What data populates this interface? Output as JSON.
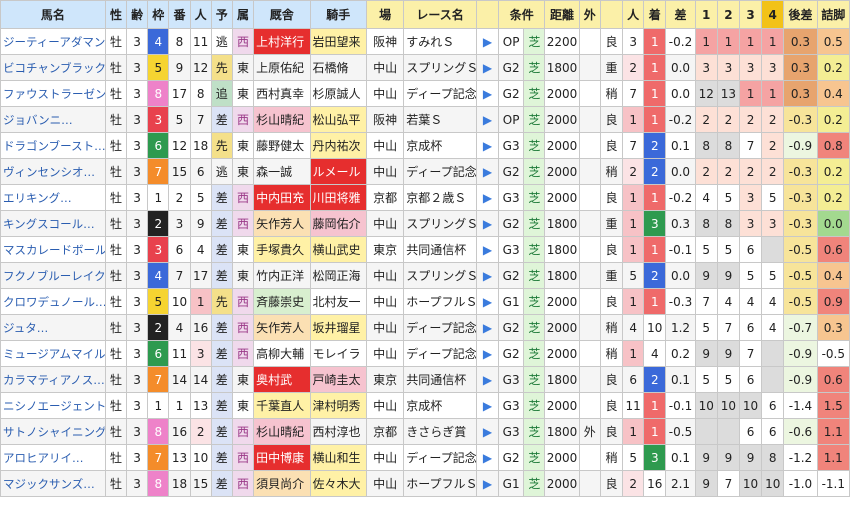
{
  "headers": [
    "馬名",
    "性",
    "齢",
    "枠",
    "番",
    "人",
    "予",
    "属",
    "厩舎",
    "騎手",
    "場",
    "レース名",
    "",
    "条件",
    "",
    "距離",
    "外",
    "",
    "人",
    "着",
    "差",
    "1",
    "2",
    "3",
    "4",
    "後差",
    "詰脚"
  ],
  "rows": [
    {
      "name": "ジーティーアダマン…",
      "sex": "牡",
      "age": "3",
      "waku": "4",
      "ban": "8",
      "pop": "11",
      "style": "逃",
      "zoku": "西",
      "trainer": "上村洋行",
      "jockey": "岩田望来",
      "place": "阪神",
      "race": "すみれＳ",
      "grade": "OP",
      "surf": "芝",
      "dist": "2200",
      "out": "",
      "cond": "良",
      "pop2": "3",
      "chaku": "1",
      "sa": "-0.2",
      "c1": "1",
      "c2": "1",
      "c3": "1",
      "c4": "1",
      "ato": "0.3",
      "tsume": "0.5"
    },
    {
      "name": "ビコチャンブラック…",
      "sex": "牡",
      "age": "3",
      "waku": "5",
      "ban": "9",
      "pop": "12",
      "style": "先",
      "zoku": "東",
      "trainer": "上原佑紀",
      "jockey": "石橋脩",
      "place": "中山",
      "race": "スプリングＳ",
      "grade": "G2",
      "surf": "芝",
      "dist": "1800",
      "out": "",
      "cond": "重",
      "pop2": "2",
      "chaku": "1",
      "sa": "0.0",
      "c1": "3",
      "c2": "3",
      "c3": "3",
      "c4": "3",
      "ato": "0.3",
      "tsume": "0.2"
    },
    {
      "name": "ファウストラーゼン…",
      "sex": "牡",
      "age": "3",
      "waku": "8",
      "ban": "17",
      "pop": "8",
      "style": "追",
      "zoku": "東",
      "trainer": "西村真幸",
      "jockey": "杉原誠人",
      "place": "中山",
      "race": "ディープ記念",
      "grade": "G2",
      "surf": "芝",
      "dist": "2000",
      "out": "",
      "cond": "稍",
      "pop2": "7",
      "chaku": "1",
      "sa": "0.0",
      "c1": "12",
      "c2": "13",
      "c3": "1",
      "c4": "1",
      "ato": "0.3",
      "tsume": "0.4"
    },
    {
      "name": "ジョバンニ…",
      "sex": "牡",
      "age": "3",
      "waku": "3",
      "ban": "5",
      "pop": "7",
      "style": "差",
      "zoku": "西",
      "trainer": "杉山晴紀",
      "jockey": "松山弘平",
      "place": "阪神",
      "race": "若葉Ｓ",
      "grade": "OP",
      "surf": "芝",
      "dist": "2000",
      "out": "",
      "cond": "良",
      "pop2": "1",
      "chaku": "1",
      "sa": "-0.2",
      "c1": "2",
      "c2": "2",
      "c3": "2",
      "c4": "2",
      "ato": "-0.3",
      "tsume": "0.2"
    },
    {
      "name": "ドラゴンブースト…",
      "sex": "牡",
      "age": "3",
      "waku": "6",
      "ban": "12",
      "pop": "18",
      "style": "先",
      "zoku": "東",
      "trainer": "藤野健太",
      "jockey": "丹内祐次",
      "place": "中山",
      "race": "京成杯",
      "grade": "G3",
      "surf": "芝",
      "dist": "2000",
      "out": "",
      "cond": "良",
      "pop2": "7",
      "chaku": "2",
      "sa": "0.1",
      "c1": "8",
      "c2": "8",
      "c3": "7",
      "c4": "2",
      "ato": "-0.9",
      "tsume": "0.8"
    },
    {
      "name": "ヴィンセンシオ…",
      "sex": "牡",
      "age": "3",
      "waku": "7",
      "ban": "15",
      "pop": "6",
      "style": "逃",
      "zoku": "東",
      "trainer": "森一誠",
      "jockey": "ルメール",
      "place": "中山",
      "race": "ディープ記念",
      "grade": "G2",
      "surf": "芝",
      "dist": "2000",
      "out": "",
      "cond": "稍",
      "pop2": "2",
      "chaku": "2",
      "sa": "0.0",
      "c1": "2",
      "c2": "2",
      "c3": "2",
      "c4": "2",
      "ato": "-0.3",
      "tsume": "0.2"
    },
    {
      "name": "エリキング…",
      "sex": "牡",
      "age": "3",
      "waku": "1",
      "ban": "2",
      "pop": "5",
      "style": "差",
      "zoku": "西",
      "trainer": "中内田充",
      "jockey": "川田将雅",
      "place": "京都",
      "race": "京都２歳Ｓ",
      "grade": "G3",
      "surf": "芝",
      "dist": "2000",
      "out": "",
      "cond": "良",
      "pop2": "1",
      "chaku": "1",
      "sa": "-0.2",
      "c1": "4",
      "c2": "5",
      "c3": "3",
      "c4": "5",
      "ato": "-0.3",
      "tsume": "0.2"
    },
    {
      "name": "キングスコール…",
      "sex": "牡",
      "age": "3",
      "waku": "2",
      "ban": "3",
      "pop": "9",
      "style": "差",
      "zoku": "西",
      "trainer": "矢作芳人",
      "jockey": "藤岡佑介",
      "place": "中山",
      "race": "スプリングＳ",
      "grade": "G2",
      "surf": "芝",
      "dist": "1800",
      "out": "",
      "cond": "重",
      "pop2": "1",
      "chaku": "3",
      "sa": "0.3",
      "c1": "8",
      "c2": "8",
      "c3": "3",
      "c4": "3",
      "ato": "-0.3",
      "tsume": "0.0"
    },
    {
      "name": "マスカレードボール…",
      "sex": "牡",
      "age": "3",
      "waku": "3",
      "ban": "6",
      "pop": "4",
      "style": "差",
      "zoku": "東",
      "trainer": "手塚貴久",
      "jockey": "横山武史",
      "place": "東京",
      "race": "共同通信杯",
      "grade": "G3",
      "surf": "芝",
      "dist": "1800",
      "out": "",
      "cond": "良",
      "pop2": "1",
      "chaku": "1",
      "sa": "-0.1",
      "c1": "5",
      "c2": "5",
      "c3": "6",
      "c4": "",
      "ato": "-0.5",
      "tsume": "0.6"
    },
    {
      "name": "フクノブルーレイク…",
      "sex": "牡",
      "age": "3",
      "waku": "4",
      "ban": "7",
      "pop": "17",
      "style": "差",
      "zoku": "東",
      "trainer": "竹内正洋",
      "jockey": "松岡正海",
      "place": "中山",
      "race": "スプリングＳ",
      "grade": "G2",
      "surf": "芝",
      "dist": "1800",
      "out": "",
      "cond": "重",
      "pop2": "5",
      "chaku": "2",
      "sa": "0.0",
      "c1": "9",
      "c2": "9",
      "c3": "5",
      "c4": "5",
      "ato": "-0.5",
      "tsume": "0.4"
    },
    {
      "name": "クロワデュノール…",
      "sex": "牡",
      "age": "3",
      "waku": "5",
      "ban": "10",
      "pop": "1",
      "style": "先",
      "zoku": "西",
      "trainer": "斉藤崇史",
      "jockey": "北村友一",
      "place": "中山",
      "race": "ホープフルＳ",
      "grade": "G1",
      "surf": "芝",
      "dist": "2000",
      "out": "",
      "cond": "良",
      "pop2": "1",
      "chaku": "1",
      "sa": "-0.3",
      "c1": "7",
      "c2": "4",
      "c3": "4",
      "c4": "4",
      "ato": "-0.5",
      "tsume": "0.9"
    },
    {
      "name": "ジュタ…",
      "sex": "牡",
      "age": "3",
      "waku": "2",
      "ban": "4",
      "pop": "16",
      "style": "差",
      "zoku": "西",
      "trainer": "矢作芳人",
      "jockey": "坂井瑠星",
      "place": "中山",
      "race": "ディープ記念",
      "grade": "G2",
      "surf": "芝",
      "dist": "2000",
      "out": "",
      "cond": "稍",
      "pop2": "4",
      "chaku": "10",
      "sa": "1.2",
      "c1": "5",
      "c2": "7",
      "c3": "6",
      "c4": "4",
      "ato": "-0.7",
      "tsume": "0.3"
    },
    {
      "name": "ミュージアムマイル…",
      "sex": "牡",
      "age": "3",
      "waku": "6",
      "ban": "11",
      "pop": "3",
      "style": "差",
      "zoku": "西",
      "trainer": "高柳大輔",
      "jockey": "モレイラ",
      "place": "中山",
      "race": "ディープ記念",
      "grade": "G2",
      "surf": "芝",
      "dist": "2000",
      "out": "",
      "cond": "稍",
      "pop2": "1",
      "chaku": "4",
      "sa": "0.2",
      "c1": "9",
      "c2": "9",
      "c3": "7",
      "c4": "",
      "ato": "-0.9",
      "tsume": "-0.5"
    },
    {
      "name": "カラマティアノス…",
      "sex": "牡",
      "age": "3",
      "waku": "7",
      "ban": "14",
      "pop": "14",
      "style": "差",
      "zoku": "東",
      "trainer": "奥村武",
      "jockey": "戸崎圭太",
      "place": "東京",
      "race": "共同通信杯",
      "grade": "G3",
      "surf": "芝",
      "dist": "1800",
      "out": "",
      "cond": "良",
      "pop2": "6",
      "chaku": "2",
      "sa": "0.1",
      "c1": "5",
      "c2": "5",
      "c3": "6",
      "c4": "",
      "ato": "-0.9",
      "tsume": "0.6"
    },
    {
      "name": "ニシノエージェント…",
      "sex": "牡",
      "age": "3",
      "waku": "1",
      "ban": "1",
      "pop": "13",
      "style": "差",
      "zoku": "東",
      "trainer": "千葉直人",
      "jockey": "津村明秀",
      "place": "中山",
      "race": "京成杯",
      "grade": "G3",
      "surf": "芝",
      "dist": "2000",
      "out": "",
      "cond": "良",
      "pop2": "11",
      "chaku": "1",
      "sa": "-0.1",
      "c1": "10",
      "c2": "10",
      "c3": "10",
      "c4": "6",
      "ato": "-1.4",
      "tsume": "1.5"
    },
    {
      "name": "サトノシャイニング…",
      "sex": "牡",
      "age": "3",
      "waku": "8",
      "ban": "16",
      "pop": "2",
      "style": "差",
      "zoku": "西",
      "trainer": "杉山晴紀",
      "jockey": "西村淳也",
      "place": "京都",
      "race": "きさらぎ賞",
      "grade": "G3",
      "surf": "芝",
      "dist": "1800",
      "out": "外",
      "cond": "良",
      "pop2": "1",
      "chaku": "1",
      "sa": "-0.5",
      "c1": "",
      "c2": "",
      "c3": "6",
      "c4": "6",
      "ato": "-0.6",
      "tsume": "1.1"
    },
    {
      "name": "アロヒアリイ…",
      "sex": "牡",
      "age": "3",
      "waku": "7",
      "ban": "13",
      "pop": "10",
      "style": "差",
      "zoku": "西",
      "trainer": "田中博康",
      "jockey": "横山和生",
      "place": "中山",
      "race": "ディープ記念",
      "grade": "G2",
      "surf": "芝",
      "dist": "2000",
      "out": "",
      "cond": "稍",
      "pop2": "5",
      "chaku": "3",
      "sa": "0.1",
      "c1": "9",
      "c2": "9",
      "c3": "9",
      "c4": "8",
      "ato": "-1.2",
      "tsume": "1.1"
    },
    {
      "name": "マジックサンズ…",
      "sex": "牡",
      "age": "3",
      "waku": "8",
      "ban": "18",
      "pop": "15",
      "style": "差",
      "zoku": "西",
      "trainer": "須貝尚介",
      "jockey": "佐々木大",
      "place": "中山",
      "race": "ホープフルＳ",
      "grade": "G1",
      "surf": "芝",
      "dist": "2000",
      "out": "",
      "cond": "良",
      "pop2": "2",
      "chaku": "16",
      "sa": "2.1",
      "c1": "9",
      "c2": "7",
      "c3": "10",
      "c4": "10",
      "ato": "-1.0",
      "tsume": "-1.1"
    }
  ]
}
